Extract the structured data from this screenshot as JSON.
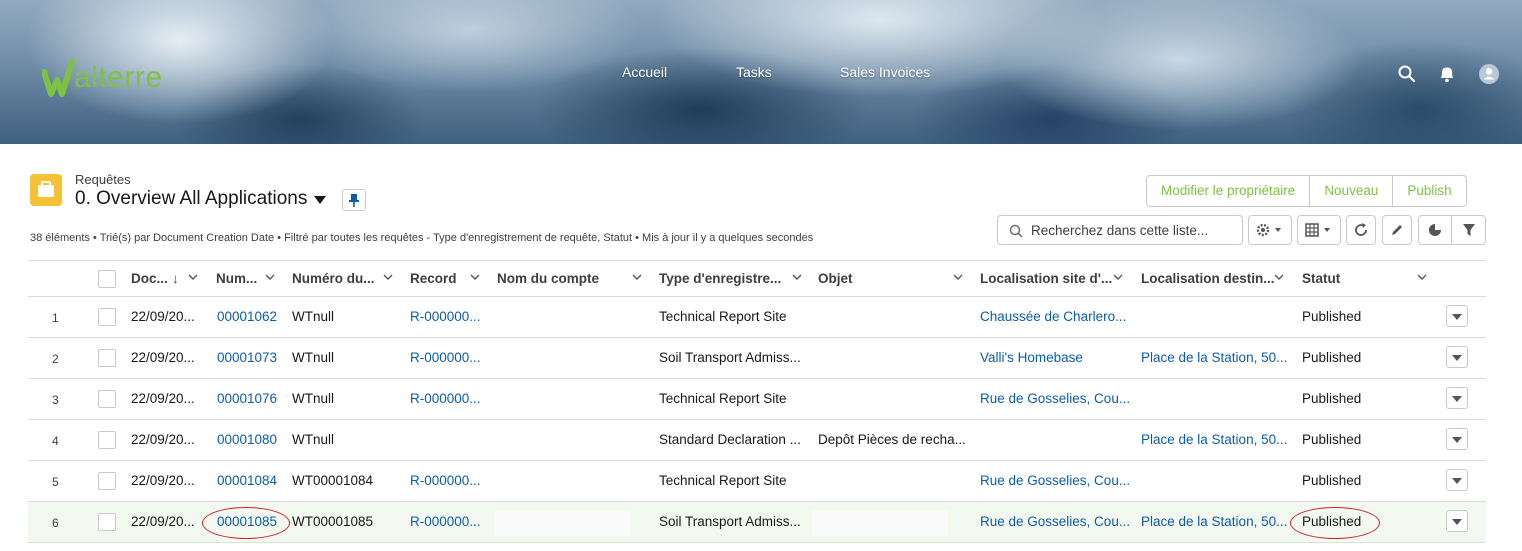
{
  "header": {
    "logo_text": "alterre",
    "nav": [
      "Accueil",
      "Tasks",
      "Sales Invoices"
    ],
    "icons": [
      "search-icon",
      "bell-icon",
      "user-avatar-icon"
    ]
  },
  "list": {
    "object_label": "Requêtes",
    "title": "0. Overview All Applications",
    "summary": "38 éléments • Trié(s) par Document Creation Date • Filtré par toutes les requêtes - Type d'enregistrement de requête, Statut • Mis à jour il y a quelques secondes",
    "buttons": [
      "Modifier le propriétaire",
      "Nouveau",
      "Publish"
    ],
    "search_placeholder": "Recherchez dans cette liste..."
  },
  "table": {
    "columns": [
      "Doc...",
      "Num...",
      "Numéro du...",
      "Record",
      "Nom du compte",
      "Type d'enregistre...",
      "Objet",
      "Localisation site d'...",
      "Localisation destin...",
      "Statut"
    ],
    "sort_indicator": "↓",
    "rows": [
      {
        "n": "1",
        "doc": "22/09/20...",
        "num": "00001062",
        "numero": "WTnull",
        "record": "R-000000...",
        "compte": "",
        "type": "Technical Report Site",
        "objet": "",
        "site": "Chaussée de Charlero...",
        "dest": "",
        "statut": "Published"
      },
      {
        "n": "2",
        "doc": "22/09/20...",
        "num": "00001073",
        "numero": "WTnull",
        "record": "R-000000...",
        "compte": "",
        "type": "Soil Transport Admiss...",
        "objet": "",
        "site": "Valli's Homebase",
        "dest": "Place de la Station, 50...",
        "statut": "Published"
      },
      {
        "n": "3",
        "doc": "22/09/20...",
        "num": "00001076",
        "numero": "WTnull",
        "record": "R-000000...",
        "compte": "",
        "type": "Technical Report Site",
        "objet": "",
        "site": "Rue de Gosselies, Cou...",
        "dest": "",
        "statut": "Published"
      },
      {
        "n": "4",
        "doc": "22/09/20...",
        "num": "00001080",
        "numero": "WTnull",
        "record": "",
        "compte": "",
        "type": "Standard Declaration ...",
        "objet": "Depôt Pièces de recha...",
        "site": "",
        "dest": "Place de la Station, 50...",
        "statut": "Published"
      },
      {
        "n": "5",
        "doc": "22/09/20...",
        "num": "00001084",
        "numero": "WT00001084",
        "record": "R-000000...",
        "compte": "",
        "type": "Technical Report Site",
        "objet": "",
        "site": "Rue de Gosselies, Cou...",
        "dest": "",
        "statut": "Published"
      },
      {
        "n": "6",
        "doc": "22/09/20...",
        "num": "00001085",
        "numero": "WT00001085",
        "record": "R-000000...",
        "compte": "",
        "type": "Soil Transport Admiss...",
        "objet": "",
        "site": "Rue de Gosselies, Cou...",
        "dest": "Place de la Station, 50...",
        "statut": "Published"
      }
    ]
  },
  "colors": {
    "brand_green": "#7dc242",
    "link_blue": "#0b5cab",
    "annotation_red": "#d2232a",
    "object_icon": "#f5c236"
  }
}
